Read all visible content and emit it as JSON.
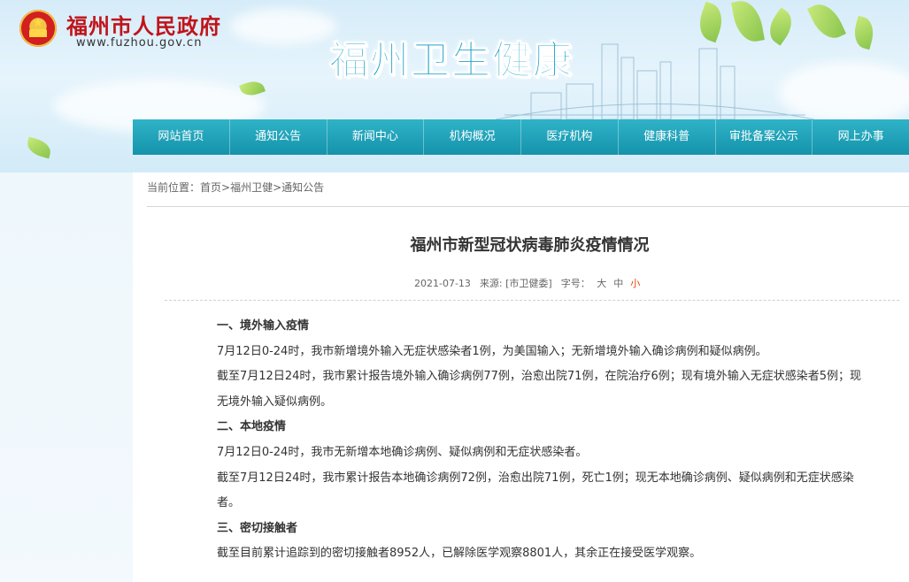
{
  "header": {
    "site_name": "福州市人民政府",
    "site_url": "www.fuzhou.gov.cn",
    "brand_title": "福州卫生健康"
  },
  "nav": {
    "items": [
      "网站首页",
      "通知公告",
      "新闻中心",
      "机构概况",
      "医疗机构",
      "健康科普",
      "审批备案公示",
      "网上办事"
    ]
  },
  "breadcrumb": {
    "prefix": "当前位置：",
    "links": [
      "首页",
      "福州卫健",
      "通知公告"
    ],
    "sep": ">"
  },
  "article": {
    "title": "福州市新型冠状病毒肺炎疫情情况",
    "date": "2021-07-13",
    "source_label": "来源: [市卫健委]",
    "font_size_label": "字号：",
    "font_sizes": [
      "大",
      "中",
      "小"
    ],
    "active_font_size": "小",
    "paragraphs": [
      {
        "type": "heading",
        "text": "一、境外输入疫情"
      },
      {
        "type": "text",
        "text": "7月12日0-24时，我市新增境外输入无症状感染者1例，为美国输入；无新增境外输入确诊病例和疑似病例。"
      },
      {
        "type": "text",
        "text": "截至7月12日24时，我市累计报告境外输入确诊病例77例，治愈出院71例，在院治疗6例；现有境外输入无症状感染者5例；现无境外输入疑似病例。"
      },
      {
        "type": "heading",
        "text": "二、本地疫情"
      },
      {
        "type": "text",
        "text": "7月12日0-24时，我市无新增本地确诊病例、疑似病例和无症状感染者。"
      },
      {
        "type": "text",
        "text": "截至7月12日24时，我市累计报告本地确诊病例72例，治愈出院71例，死亡1例；现无本地确诊病例、疑似病例和无症状感染者。"
      },
      {
        "type": "heading",
        "text": "三、密切接触者"
      },
      {
        "type": "text",
        "text": "截至目前累计追踪到的密切接触者8952人，已解除医学观察8801人，其余正在接受医学观察。"
      }
    ]
  },
  "colors": {
    "nav_bg": "#1fa3bb",
    "brand_text": "#1aa2c8",
    "site_name": "#c0141a",
    "active_font_size": "#e6420c"
  }
}
